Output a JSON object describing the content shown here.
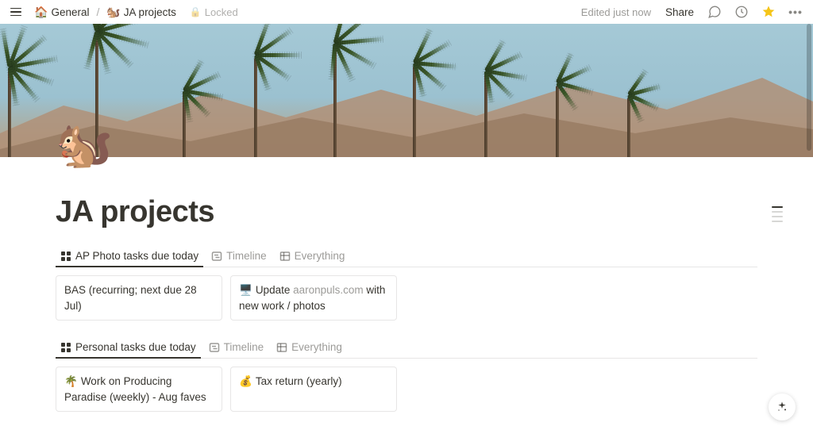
{
  "breadcrumb": {
    "home_emoji": "🏠",
    "parent": "General",
    "sep": "/",
    "page_emoji": "🐿️",
    "page": "JA projects"
  },
  "locked_label": "Locked",
  "edited_text": "Edited just now",
  "share_label": "Share",
  "page": {
    "emoji": "🐿️",
    "title": "JA projects"
  },
  "section1": {
    "tabs": [
      {
        "label": "AP Photo tasks due today",
        "active": true
      },
      {
        "label": "Timeline",
        "active": false
      },
      {
        "label": "Everything",
        "active": false
      }
    ],
    "cards": [
      {
        "emoji": "",
        "text_pre": "BAS (recurring; next due 28 Jul)",
        "text_muted": "",
        "text_post": ""
      },
      {
        "emoji": "🖥️",
        "text_pre": "Update ",
        "text_muted": "aaronpuls.com",
        "text_post": " with new work / photos"
      }
    ]
  },
  "section2": {
    "tabs": [
      {
        "label": "Personal tasks due today",
        "active": true
      },
      {
        "label": "Timeline",
        "active": false
      },
      {
        "label": "Everything",
        "active": false
      }
    ],
    "cards": [
      {
        "emoji": "🌴",
        "text_pre": "Work on Producing Paradise (weekly) - Aug faves",
        "text_muted": "",
        "text_post": ""
      },
      {
        "emoji": "💰",
        "text_pre": "Tax return (yearly)",
        "text_muted": "",
        "text_post": ""
      }
    ]
  }
}
